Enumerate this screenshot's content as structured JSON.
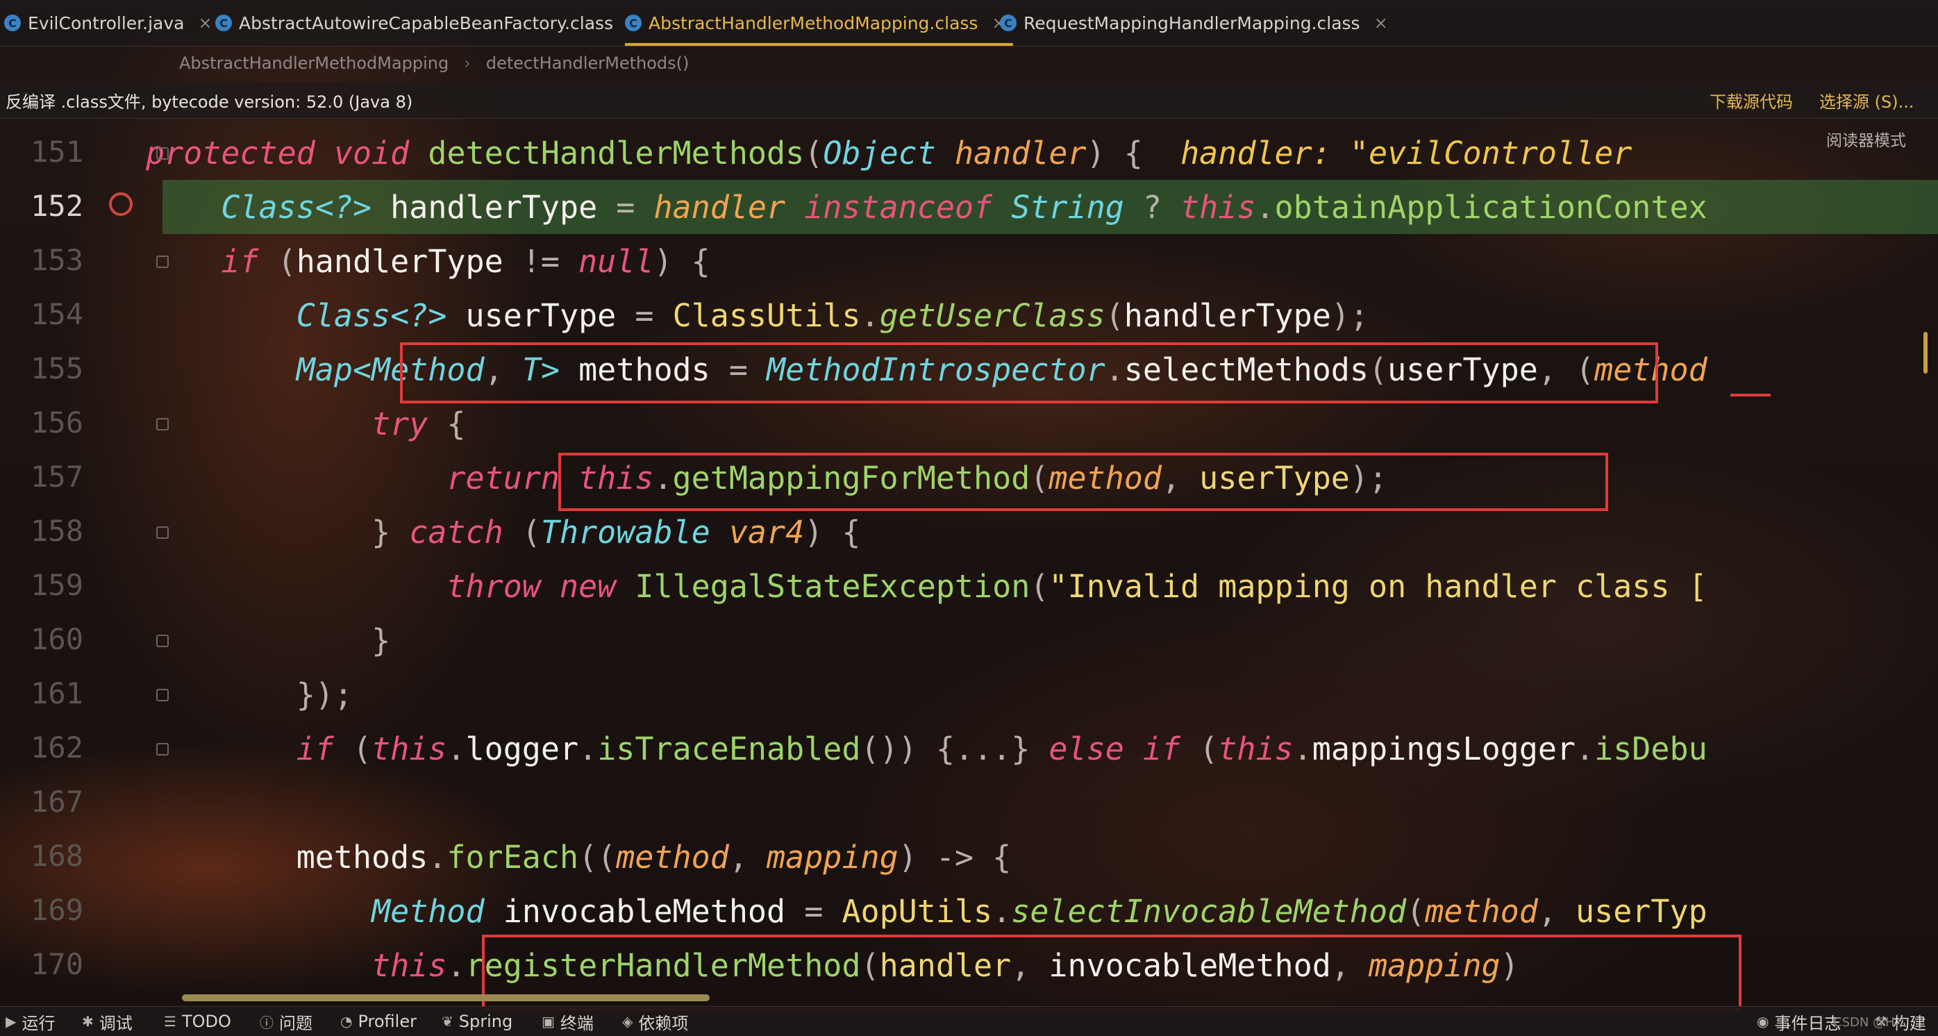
{
  "tabs": [
    {
      "label": "EvilController.java",
      "icon": "class-icon",
      "active": false
    },
    {
      "label": "AbstractAutowireCapableBeanFactory.class",
      "icon": "class-file-icon",
      "active": false
    },
    {
      "label": "AbstractHandlerMethodMapping.class",
      "icon": "class-file-icon",
      "active": true
    },
    {
      "label": "RequestMappingHandlerMapping.class",
      "icon": "class-file-icon",
      "active": false
    }
  ],
  "tab_close": "×",
  "breadcrumb": [
    "AbstractHandlerMethodMapping",
    "detectHandlerMethods()"
  ],
  "infobar": {
    "message": "反编译 .class文件, bytecode version: 52.0 (Java 8)",
    "download_source": "下载源代码",
    "choose_source": "选择源 (S)..."
  },
  "reader_mode": "阅读器模式",
  "editor": {
    "current_line": "152",
    "lines": [
      {
        "num": "151",
        "tokens": [
          {
            "t": "        "
          },
          {
            "t": "protected",
            "c": "kw"
          },
          {
            "t": " "
          },
          {
            "t": "void",
            "c": "kw"
          },
          {
            "t": " "
          },
          {
            "t": "detectHandlerMethods",
            "c": "fn"
          },
          {
            "t": "(",
            "c": "pu"
          },
          {
            "t": "Object",
            "c": "ty"
          },
          {
            "t": " "
          },
          {
            "t": "handler",
            "c": "pa"
          },
          {
            "t": ") {  ",
            "c": "pu"
          },
          {
            "t": "handler: \"evilController",
            "c": "hint"
          }
        ]
      },
      {
        "num": "152",
        "tokens": [
          {
            "t": "            "
          },
          {
            "t": "Class<?>",
            "c": "ty"
          },
          {
            "t": " handlerType ",
            "c": "id"
          },
          {
            "t": "=",
            "c": "pu"
          },
          {
            "t": " "
          },
          {
            "t": "handler",
            "c": "pa"
          },
          {
            "t": " "
          },
          {
            "t": "instanceof",
            "c": "kw"
          },
          {
            "t": " "
          },
          {
            "t": "String",
            "c": "ty"
          },
          {
            "t": " ? ",
            "c": "pu"
          },
          {
            "t": "this",
            "c": "kw"
          },
          {
            "t": ".",
            "c": "pu"
          },
          {
            "t": "obtainApplicationContex",
            "c": "fn"
          }
        ]
      },
      {
        "num": "153",
        "tokens": [
          {
            "t": "            "
          },
          {
            "t": "if",
            "c": "kw"
          },
          {
            "t": " (",
            "c": "pu"
          },
          {
            "t": "handlerType ",
            "c": "id"
          },
          {
            "t": "!=",
            "c": "pu"
          },
          {
            "t": " "
          },
          {
            "t": "null",
            "c": "kw"
          },
          {
            "t": ") {",
            "c": "pu"
          }
        ]
      },
      {
        "num": "154",
        "tokens": [
          {
            "t": "                "
          },
          {
            "t": "Class<?>",
            "c": "ty"
          },
          {
            "t": " userType ",
            "c": "id"
          },
          {
            "t": "=",
            "c": "pu"
          },
          {
            "t": " "
          },
          {
            "t": "ClassUtils",
            "c": "cl"
          },
          {
            "t": ".",
            "c": "pu"
          },
          {
            "t": "getUserClass",
            "c": "fni"
          },
          {
            "t": "(",
            "c": "pu"
          },
          {
            "t": "handlerType",
            "c": "id"
          },
          {
            "t": ");",
            "c": "pu"
          }
        ]
      },
      {
        "num": "155",
        "tokens": [
          {
            "t": "                "
          },
          {
            "t": "Map<Method",
            "c": "ty"
          },
          {
            "t": ", ",
            "c": "pu"
          },
          {
            "t": "T>",
            "c": "ty"
          },
          {
            "t": " methods ",
            "c": "id"
          },
          {
            "t": "=",
            "c": "pu"
          },
          {
            "t": " "
          },
          {
            "t": "MethodIntrospector",
            "c": "ty"
          },
          {
            "t": ".",
            "c": "pu"
          },
          {
            "t": "selectMethods",
            "c": "id"
          },
          {
            "t": "(",
            "c": "pu"
          },
          {
            "t": "userType",
            "c": "id"
          },
          {
            "t": ", (",
            "c": "pu"
          },
          {
            "t": "method",
            "c": "pa"
          }
        ]
      },
      {
        "num": "156",
        "tokens": [
          {
            "t": "                    "
          },
          {
            "t": "try",
            "c": "kw"
          },
          {
            "t": " {",
            "c": "pu"
          }
        ]
      },
      {
        "num": "157",
        "tokens": [
          {
            "t": "                        "
          },
          {
            "t": "return",
            "c": "kw"
          },
          {
            "t": " "
          },
          {
            "t": "this",
            "c": "kw"
          },
          {
            "t": ".",
            "c": "pu"
          },
          {
            "t": "getMappingForMethod",
            "c": "fn"
          },
          {
            "t": "(",
            "c": "pu"
          },
          {
            "t": "method",
            "c": "pa"
          },
          {
            "t": ", ",
            "c": "pu"
          },
          {
            "t": "userType",
            "c": "st"
          },
          {
            "t": ");",
            "c": "pu"
          }
        ]
      },
      {
        "num": "158",
        "tokens": [
          {
            "t": "                    "
          },
          {
            "t": "} ",
            "c": "pu"
          },
          {
            "t": "catch",
            "c": "kw"
          },
          {
            "t": " (",
            "c": "pu"
          },
          {
            "t": "Throwable",
            "c": "ty"
          },
          {
            "t": " "
          },
          {
            "t": "var4",
            "c": "pa"
          },
          {
            "t": ") {",
            "c": "pu"
          }
        ]
      },
      {
        "num": "159",
        "tokens": [
          {
            "t": "                        "
          },
          {
            "t": "throw",
            "c": "kw"
          },
          {
            "t": " "
          },
          {
            "t": "new",
            "c": "kw"
          },
          {
            "t": " "
          },
          {
            "t": "IllegalStateException",
            "c": "fn"
          },
          {
            "t": "(",
            "c": "pu"
          },
          {
            "t": "\"Invalid mapping on handler class [",
            "c": "st"
          }
        ]
      },
      {
        "num": "160",
        "tokens": [
          {
            "t": "                    "
          },
          {
            "t": "}",
            "c": "pu"
          }
        ]
      },
      {
        "num": "161",
        "tokens": [
          {
            "t": "                "
          },
          {
            "t": "});",
            "c": "pu"
          }
        ]
      },
      {
        "num": "162",
        "tokens": [
          {
            "t": "                "
          },
          {
            "t": "if",
            "c": "kw"
          },
          {
            "t": " (",
            "c": "pu"
          },
          {
            "t": "this",
            "c": "kw"
          },
          {
            "t": ".",
            "c": "pu"
          },
          {
            "t": "logger",
            "c": "id"
          },
          {
            "t": ".",
            "c": "pu"
          },
          {
            "t": "isTraceEnabled",
            "c": "fn"
          },
          {
            "t": "()) {...} ",
            "c": "pu"
          },
          {
            "t": "else",
            "c": "kw"
          },
          {
            "t": " "
          },
          {
            "t": "if",
            "c": "kw"
          },
          {
            "t": " (",
            "c": "pu"
          },
          {
            "t": "this",
            "c": "kw"
          },
          {
            "t": ".",
            "c": "pu"
          },
          {
            "t": "mappingsLogger",
            "c": "id"
          },
          {
            "t": ".",
            "c": "pu"
          },
          {
            "t": "isDebu",
            "c": "fn"
          }
        ]
      },
      {
        "num": "167",
        "tokens": []
      },
      {
        "num": "168",
        "tokens": [
          {
            "t": "                "
          },
          {
            "t": "methods",
            "c": "id"
          },
          {
            "t": ".",
            "c": "pu"
          },
          {
            "t": "forEach",
            "c": "fn"
          },
          {
            "t": "((",
            "c": "pu"
          },
          {
            "t": "method",
            "c": "pa"
          },
          {
            "t": ", ",
            "c": "pu"
          },
          {
            "t": "mapping",
            "c": "pa"
          },
          {
            "t": ") -> {",
            "c": "pu"
          }
        ]
      },
      {
        "num": "169",
        "tokens": [
          {
            "t": "                    "
          },
          {
            "t": "Method",
            "c": "ty"
          },
          {
            "t": " invocableMethod ",
            "c": "id"
          },
          {
            "t": "=",
            "c": "pu"
          },
          {
            "t": " "
          },
          {
            "t": "AopUtils",
            "c": "cl"
          },
          {
            "t": ".",
            "c": "pu"
          },
          {
            "t": "selectInvocableMethod",
            "c": "fni"
          },
          {
            "t": "(",
            "c": "pu"
          },
          {
            "t": "method",
            "c": "pa"
          },
          {
            "t": ", ",
            "c": "pu"
          },
          {
            "t": "userTyp",
            "c": "st"
          }
        ]
      },
      {
        "num": "170",
        "tokens": [
          {
            "t": "                    "
          },
          {
            "t": "this",
            "c": "kw"
          },
          {
            "t": ".",
            "c": "pu"
          },
          {
            "t": "registerHandlerMethod",
            "c": "fn"
          },
          {
            "t": "(",
            "c": "pu"
          },
          {
            "t": "handler",
            "c": "st"
          },
          {
            "t": ", ",
            "c": "pu"
          },
          {
            "t": "invocableMethod",
            "c": "id"
          },
          {
            "t": ", ",
            "c": "pu"
          },
          {
            "t": "mapping",
            "c": "pa"
          },
          {
            "t": ")",
            "c": "pu"
          }
        ]
      }
    ]
  },
  "toolbar": {
    "items": [
      {
        "label": "运行",
        "icon": "run-icon"
      },
      {
        "label": "调试",
        "icon": "debug-icon"
      },
      {
        "label": "TODO",
        "icon": "todo-icon"
      },
      {
        "label": "问题",
        "icon": "problems-icon"
      },
      {
        "label": "Profiler",
        "icon": "profiler-icon"
      },
      {
        "label": "Spring",
        "icon": "spring-icon"
      },
      {
        "label": "终端",
        "icon": "terminal-icon"
      },
      {
        "label": "依赖项",
        "icon": "dependencies-icon"
      }
    ],
    "event_log": "事件日志",
    "build": "构建",
    "watermark": "CSDN @H..."
  },
  "colors": {
    "keyword": "#e8547c",
    "type": "#6fd5e0",
    "function": "#9fd46a",
    "parameter": "#f0a454",
    "string": "#f0d673",
    "identifier": "#f4f1ee",
    "highlight_box": "#e03a3a",
    "active_tab": "#e7b84a",
    "current_line_bg": "#3c783c"
  }
}
